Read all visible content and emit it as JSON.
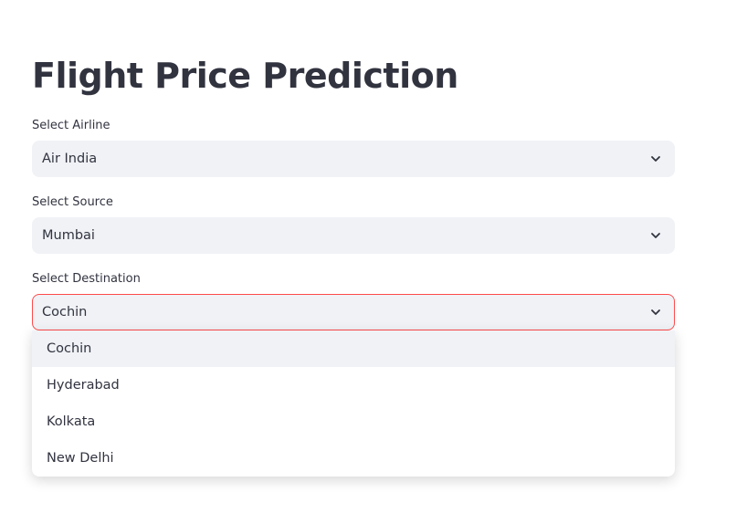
{
  "page": {
    "title": "Flight Price Prediction"
  },
  "fields": {
    "airline": {
      "label": "Select Airline",
      "value": "Air India"
    },
    "source": {
      "label": "Select Source",
      "value": "Mumbai"
    },
    "destination": {
      "label": "Select Destination",
      "value": "Cochin"
    }
  },
  "destination_dropdown": {
    "options": [
      "Cochin",
      "Hyderabad",
      "Kolkata",
      "New Delhi"
    ],
    "highlighted": "Cochin"
  },
  "colors": {
    "accent_focus_border": "#ff4b4b",
    "input_background": "#f0f2f6",
    "text": "#31333f"
  },
  "icons": {
    "select_toggle": "chevron-down-icon"
  }
}
